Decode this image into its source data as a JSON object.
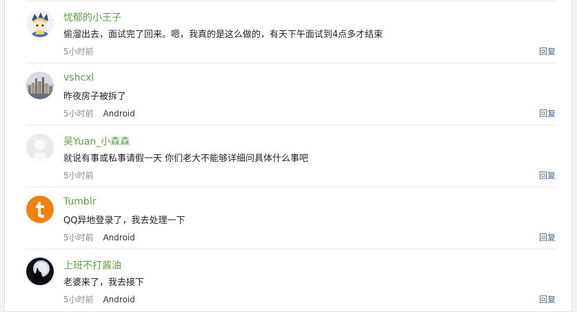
{
  "comments": [
    {
      "username": "忧郁的小王子",
      "content": "偷溜出去，面试完了回来。嗯，我真的是这么做的，有天下午面试到4点多才结束",
      "time": "5小时前",
      "device": "",
      "reply": "回复",
      "avatar": "cartoon-prince-avatar"
    },
    {
      "username": "vshcxl",
      "content": "昨夜房子被拆了",
      "time": "5小时前",
      "device": "Android",
      "reply": "回复",
      "avatar": "city-skyline-avatar"
    },
    {
      "username": "吴Yuan_小森森",
      "content": "就说有事或私事请假一天 你们老大不能够详细问具体什么事吧",
      "time": "5小时前",
      "device": "",
      "reply": "回复",
      "avatar": "default-silhouette-avatar"
    },
    {
      "username": "Tumblr",
      "content": "QQ异地登录了，我去处理一下",
      "time": "5小时前",
      "device": "Android",
      "reply": "回复",
      "avatar": "tumblr-logo-avatar"
    },
    {
      "username": "上班不打酱油",
      "content": "老婆来了，我去接下",
      "time": "5小时前",
      "device": "Android",
      "reply": "回复",
      "avatar": "howling-wolf-avatar"
    }
  ],
  "colors": {
    "username": "#5aa23b",
    "reply_link": "#3a6a9b",
    "tumblr_orange": "#f0830f"
  }
}
